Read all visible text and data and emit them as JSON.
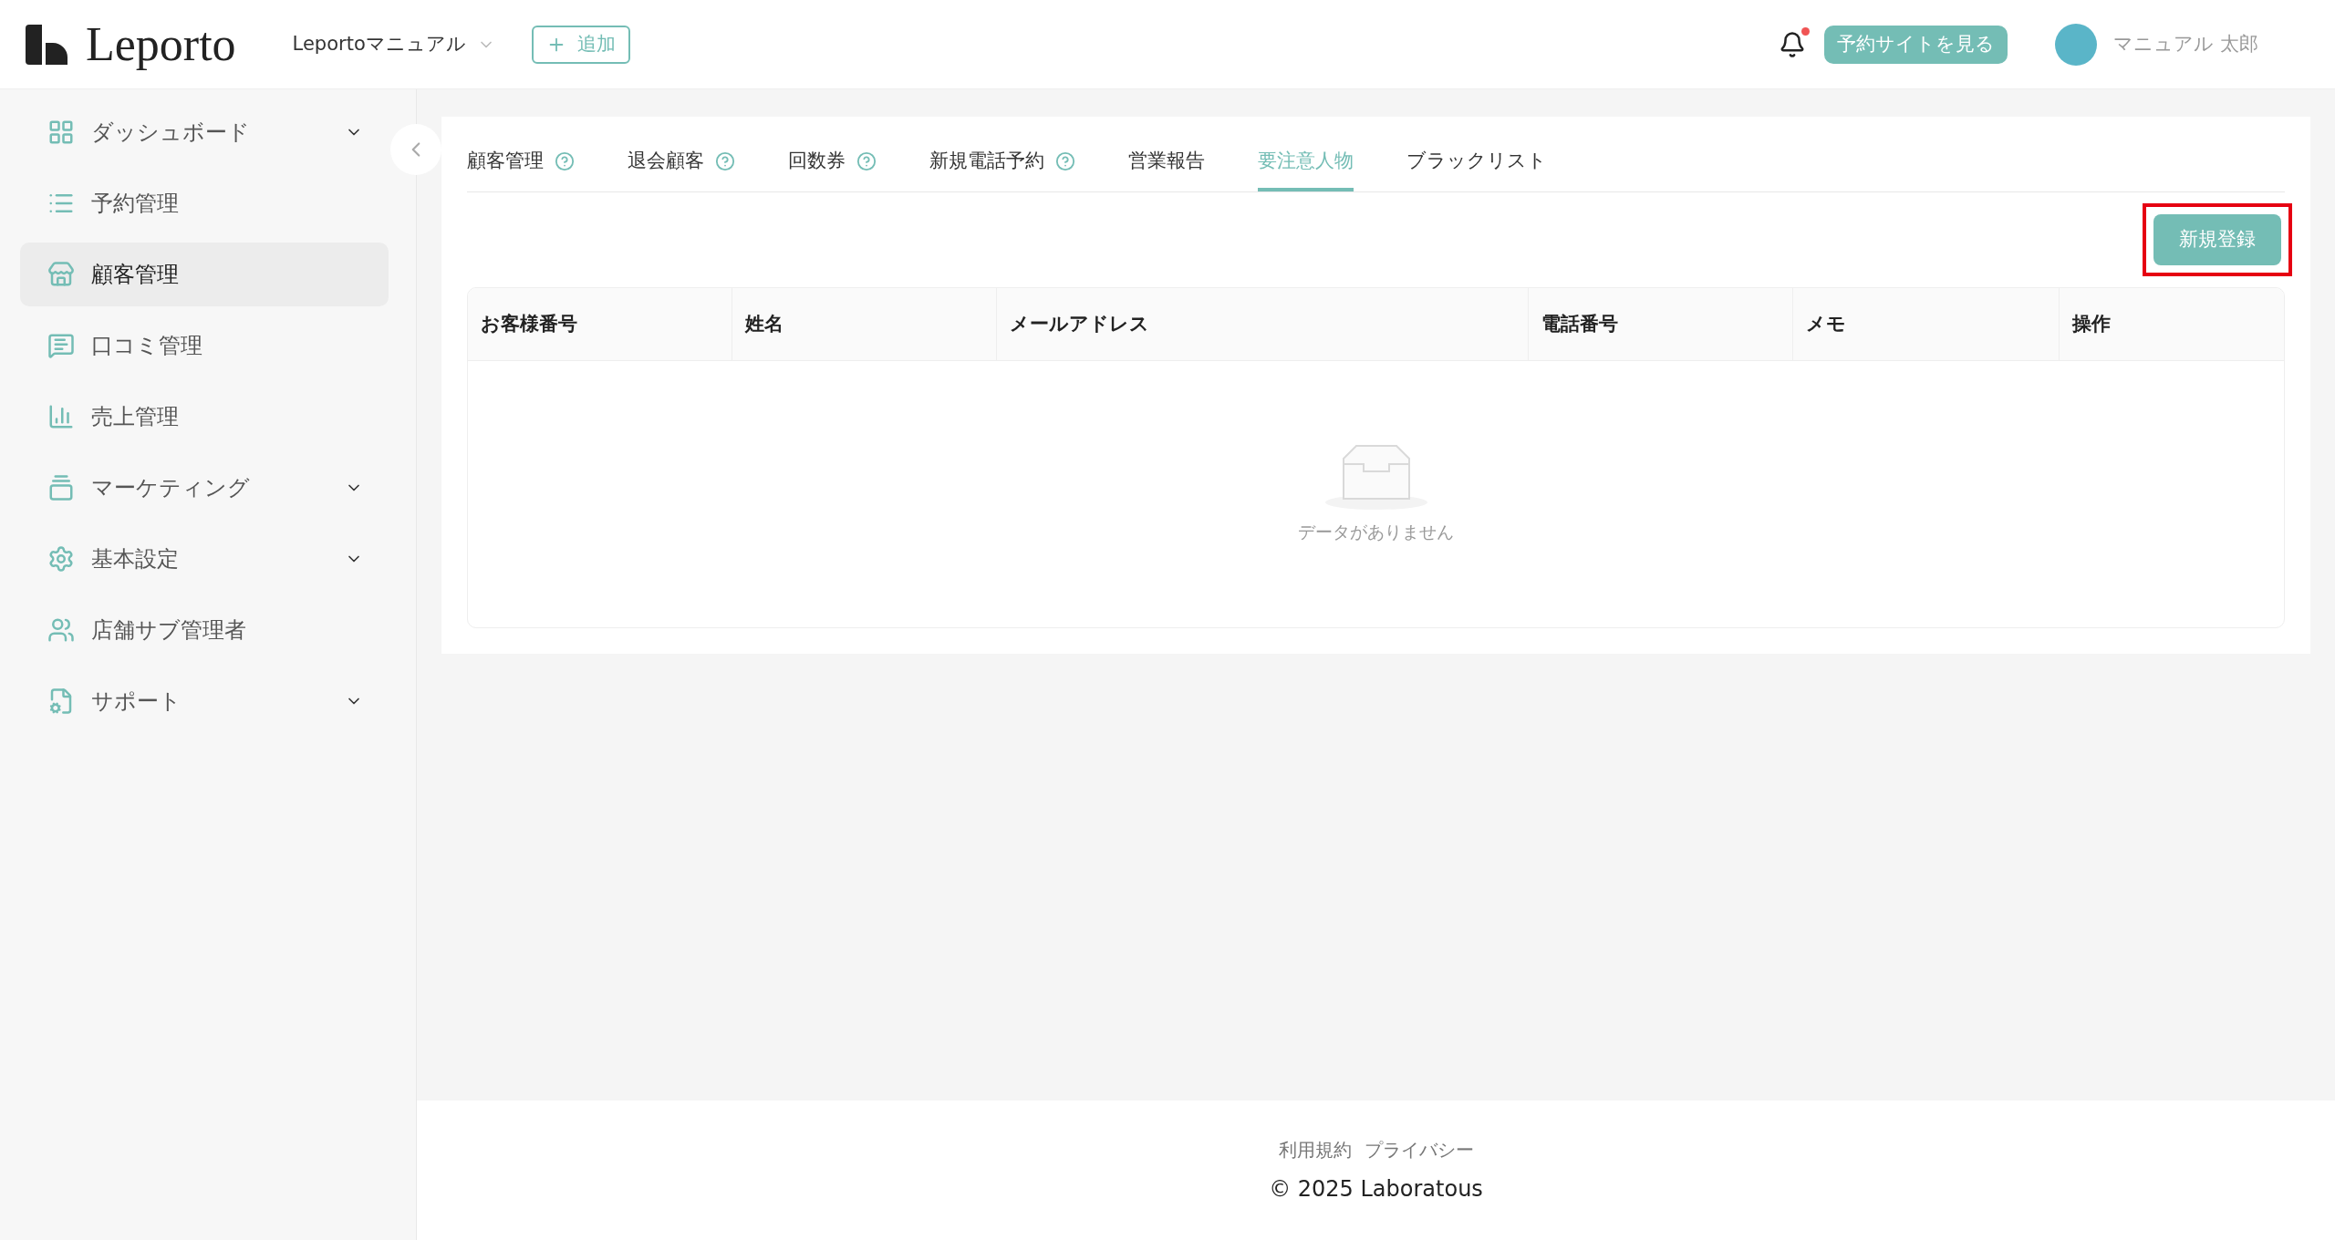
{
  "header": {
    "logo": "Leporto",
    "store_select": "Leportoマニュアル",
    "add_button": "追加",
    "notification": true,
    "site_button": "予約サイトを見る",
    "user_name": "マニュアル 太郎"
  },
  "sidebar": {
    "items": [
      {
        "label": "ダッシュボード",
        "expandable": true,
        "selected": false
      },
      {
        "label": "予約管理",
        "expandable": false,
        "selected": false
      },
      {
        "label": "顧客管理",
        "expandable": false,
        "selected": true
      },
      {
        "label": "口コミ管理",
        "expandable": false,
        "selected": false
      },
      {
        "label": "売上管理",
        "expandable": false,
        "selected": false
      },
      {
        "label": "マーケティング",
        "expandable": true,
        "selected": false
      },
      {
        "label": "基本設定",
        "expandable": true,
        "selected": false
      },
      {
        "label": "店舗サブ管理者",
        "expandable": false,
        "selected": false
      },
      {
        "label": "サポート",
        "expandable": true,
        "selected": false
      }
    ]
  },
  "tabs": [
    {
      "label": "顧客管理",
      "help": true,
      "selected": false
    },
    {
      "label": "退会顧客",
      "help": true,
      "selected": false
    },
    {
      "label": "回数券",
      "help": true,
      "selected": false
    },
    {
      "label": "新規電話予約",
      "help": true,
      "selected": false
    },
    {
      "label": "営業報告",
      "help": false,
      "selected": false
    },
    {
      "label": "要注意人物",
      "help": false,
      "selected": true
    },
    {
      "label": "ブラックリスト",
      "help": false,
      "selected": false
    }
  ],
  "new_button": {
    "label": "新規登録",
    "highlighted": true
  },
  "table": {
    "columns": [
      "お客様番号",
      "姓名",
      "メールアドレス",
      "電話番号",
      "メモ",
      "操作"
    ],
    "empty_text": "データがありません"
  },
  "footer": {
    "links": [
      "利用規約",
      "プライバシー"
    ],
    "copyright": "© 2025 Laboratous"
  }
}
